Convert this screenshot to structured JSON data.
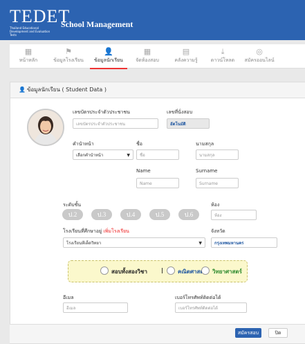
{
  "header": {
    "logo": "TEDET",
    "logo_sub1": "Thailand Educational",
    "logo_sub2": "Development and Evaluation Tests",
    "app_title": "School Management"
  },
  "nav": [
    {
      "label": "หน้าหลัก",
      "icon": "grid-icon",
      "active": false
    },
    {
      "label": "ข้อมูลโรงเรียน",
      "icon": "flag-icon",
      "active": false
    },
    {
      "label": "ข้อมูลนักเรียน",
      "icon": "user-icon",
      "active": true
    },
    {
      "label": "จัดห้องสอบ",
      "icon": "grid-9-icon",
      "active": false
    },
    {
      "label": "คลังความรู้",
      "icon": "book-icon",
      "active": false
    },
    {
      "label": "ดาวน์โหลด",
      "icon": "download-icon",
      "active": false
    },
    {
      "label": "สมัครออนไลน์",
      "icon": "globe-icon",
      "active": false
    }
  ],
  "card": {
    "title": "ข้อมูลนักเรียน ( Student Data )"
  },
  "form": {
    "id_label": "เลขบัตรประจำตัวประชาชน",
    "id_placeholder": "เลขบัตรประจำตัวประชาชน",
    "exam_no_label": "เลขที่นั่งสอบ",
    "exam_no_value": "อัตโนมัติ",
    "prefix_label": "คำนำหน้า",
    "prefix_value": "เลือกคำนำหน้า",
    "name_th_label": "ชื่อ",
    "name_th_placeholder": "ชื่อ",
    "surname_th_label": "นามสกุล",
    "surname_th_placeholder": "นามสกุล",
    "name_en_label": "Name",
    "name_en_placeholder": "Name",
    "surname_en_label": "Surname",
    "surname_en_placeholder": "Surname",
    "grade_label": "ระดับชั้น",
    "grades": [
      "ป.2",
      "ป.3",
      "ป.4",
      "ป.5",
      "ป.6"
    ],
    "room_label": "ห้อง",
    "room_placeholder": "ห้อง",
    "school_label": "โรงเรียนที่ศึกษาอยู่",
    "school_add_link": "เพิ่มโรงเรียน",
    "school_value": "โรงเรียนทีเด็ดวิทยา",
    "province_label": "จังหวัด",
    "province_value": "กรุงเทพมหานคร",
    "subjects": {
      "both": "สอบทั้งสองวิชา",
      "separator": "|",
      "math": "คณิตศาสตร์",
      "science": "วิทยาศาสตร์"
    },
    "email_label": "อีเมล",
    "email_placeholder": "อีเมล",
    "phone_label": "เบอร์โทรศัพท์ติดต่อได้",
    "phone_placeholder": "เบอร์โทรศัพท์ติดต่อได้"
  },
  "actions": {
    "submit": "สมัครสอบ",
    "close": "ปิด"
  },
  "colors": {
    "header_blue": "#2c63b1",
    "accent_red": "#e22222",
    "math_blue": "#1e56a0",
    "science_green": "#2e8b2e",
    "subject_bg": "#fbf8cc"
  }
}
